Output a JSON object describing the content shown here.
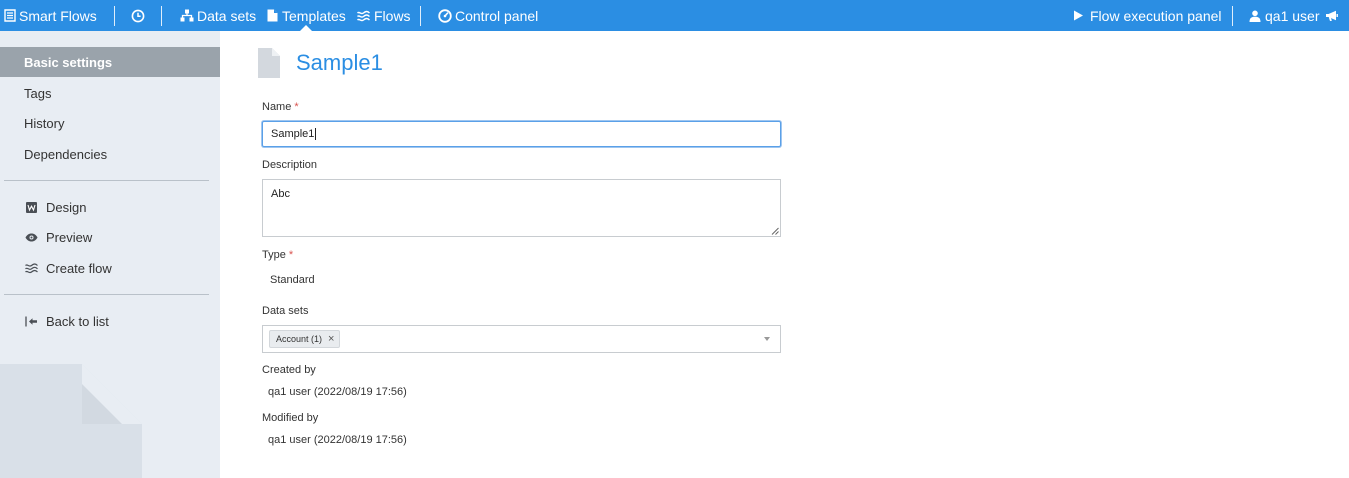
{
  "topbar": {
    "brand": "Smart Flows",
    "datasets": "Data sets",
    "templates": "Templates",
    "flows": "Flows",
    "control_panel": "Control panel",
    "flow_execution_panel": "Flow execution panel",
    "user": "qa1 user",
    "accent_color": "#2b8ee3"
  },
  "sidebar": {
    "basic_settings": "Basic settings",
    "tags": "Tags",
    "history": "History",
    "dependencies": "Dependencies",
    "design": "Design",
    "preview": "Preview",
    "create_flow": "Create flow",
    "back_to_list": "Back to list"
  },
  "form": {
    "title": "Sample1",
    "name_label": "Name",
    "name_value": "Sample1",
    "required_mark": "*",
    "description_label": "Description",
    "description_value": "Abc",
    "type_label": "Type",
    "type_value": "Standard",
    "datasets_label": "Data sets",
    "dataset_chip": "Account (1)",
    "chip_remove": "×",
    "created_by_label": "Created by",
    "created_by_value": "qa1 user (2022/08/19 17:56)",
    "modified_by_label": "Modified by",
    "modified_by_value": "qa1 user (2022/08/19 17:56)"
  }
}
